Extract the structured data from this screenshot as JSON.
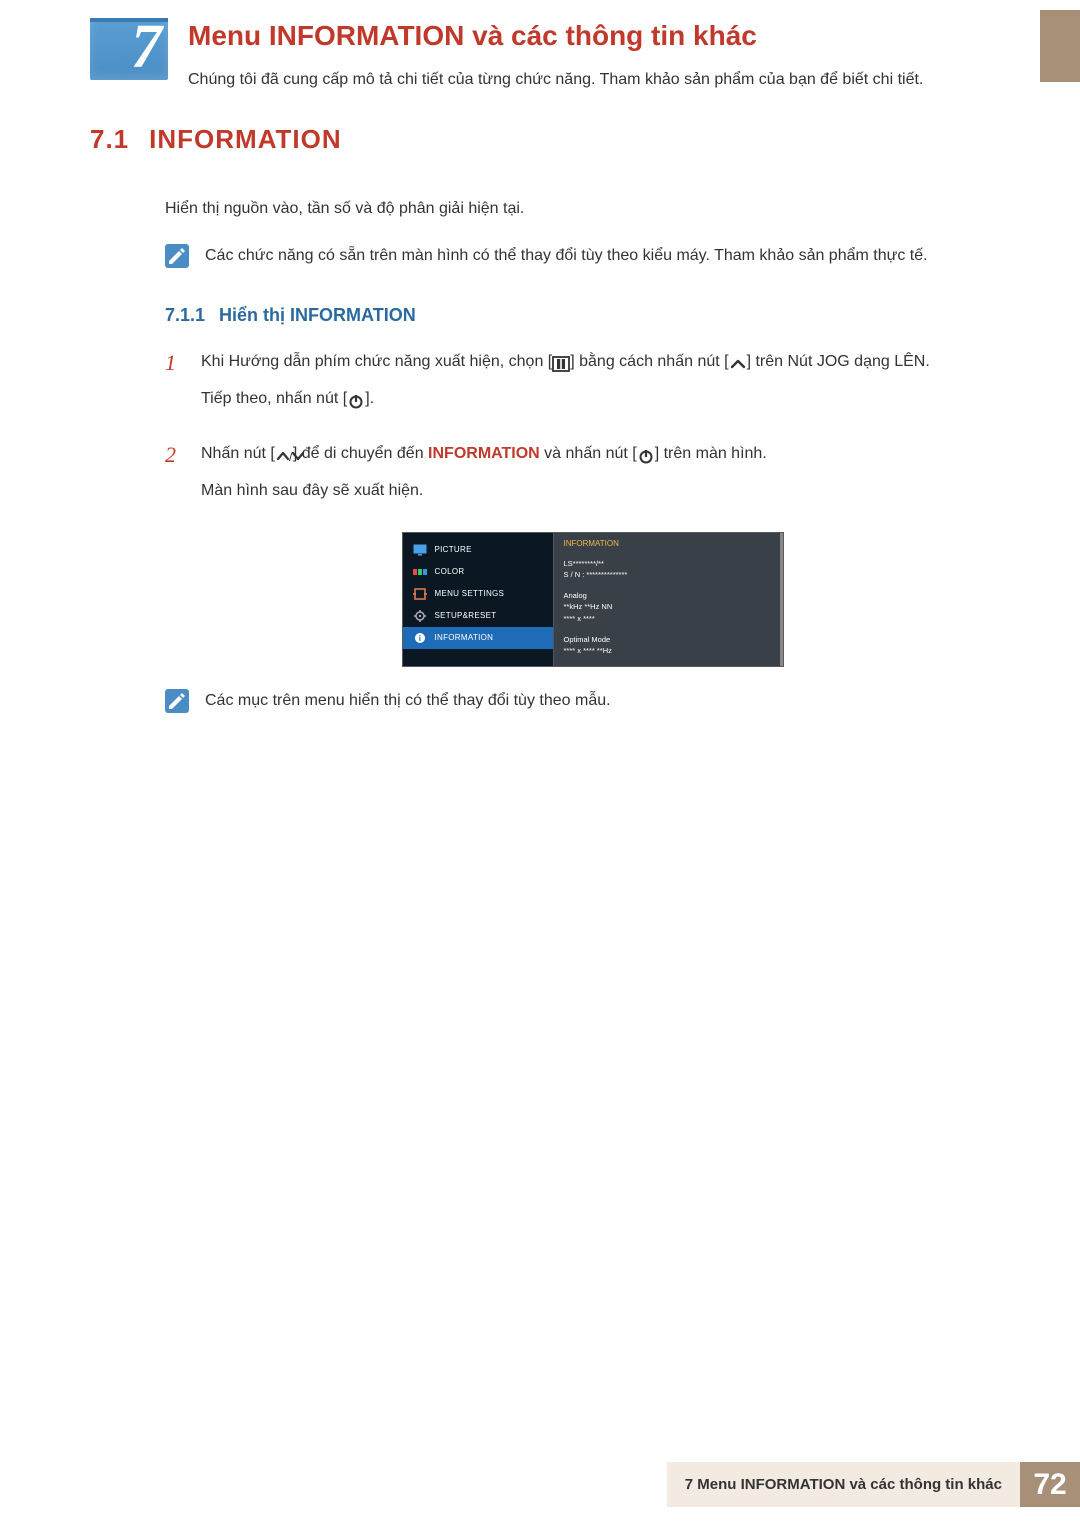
{
  "chapter": {
    "number": "7",
    "title": "Menu INFORMATION và các thông tin khác",
    "intro": "Chúng tôi đã cung cấp mô tả chi tiết của từng chức năng. Tham khảo sản phẩm của bạn để biết chi tiết."
  },
  "section": {
    "num": "7.1",
    "title": "INFORMATION",
    "body": "Hiển thị nguồn vào, tần số và độ phân giải hiện tại.",
    "note": "Các chức năng có sẵn trên màn hình có thể thay đổi tùy theo kiểu máy. Tham khảo sản phẩm thực tế."
  },
  "subsection": {
    "num": "7.1.1",
    "title": "Hiển thị INFORMATION"
  },
  "steps": [
    {
      "num": "1",
      "line1_pre": "Khi Hướng dẫn phím chức năng xuất hiện, chọn [",
      "line1_mid": "] bằng cách nhấn nút [",
      "line1_post": "] trên Nút JOG dạng LÊN.",
      "line2_pre": "Tiếp theo, nhấn nút [",
      "line2_post": "]."
    },
    {
      "num": "2",
      "line1_pre": "Nhấn nút [",
      "line1_mid": "] để di chuyển đến ",
      "line1_strong": "INFORMATION",
      "line1_mid2": " và nhấn nút [",
      "line1_post": "] trên màn hình.",
      "line2": "Màn hình sau đây sẽ xuất hiện."
    }
  ],
  "osd": {
    "menu": [
      {
        "icon": "monitor",
        "label": "PICTURE"
      },
      {
        "icon": "color",
        "label": "COLOR"
      },
      {
        "icon": "settings",
        "label": "MENU SETTINGS"
      },
      {
        "icon": "gear",
        "label": "SETUP&RESET"
      },
      {
        "icon": "info",
        "label": "INFORMATION",
        "selected": true
      }
    ],
    "panel_title": "INFORMATION",
    "blocks": [
      [
        "LS********/**",
        "S / N : **************"
      ],
      [
        "Analog",
        "**kHz **Hz NN",
        "**** x ****"
      ],
      [
        "Optimal Mode",
        "**** x **** **Hz"
      ]
    ]
  },
  "note2": "Các mục trên menu hiển thị có thể thay đổi tùy theo mẫu.",
  "footer": {
    "title": "7 Menu INFORMATION và các thông tin khác",
    "page": "72"
  }
}
